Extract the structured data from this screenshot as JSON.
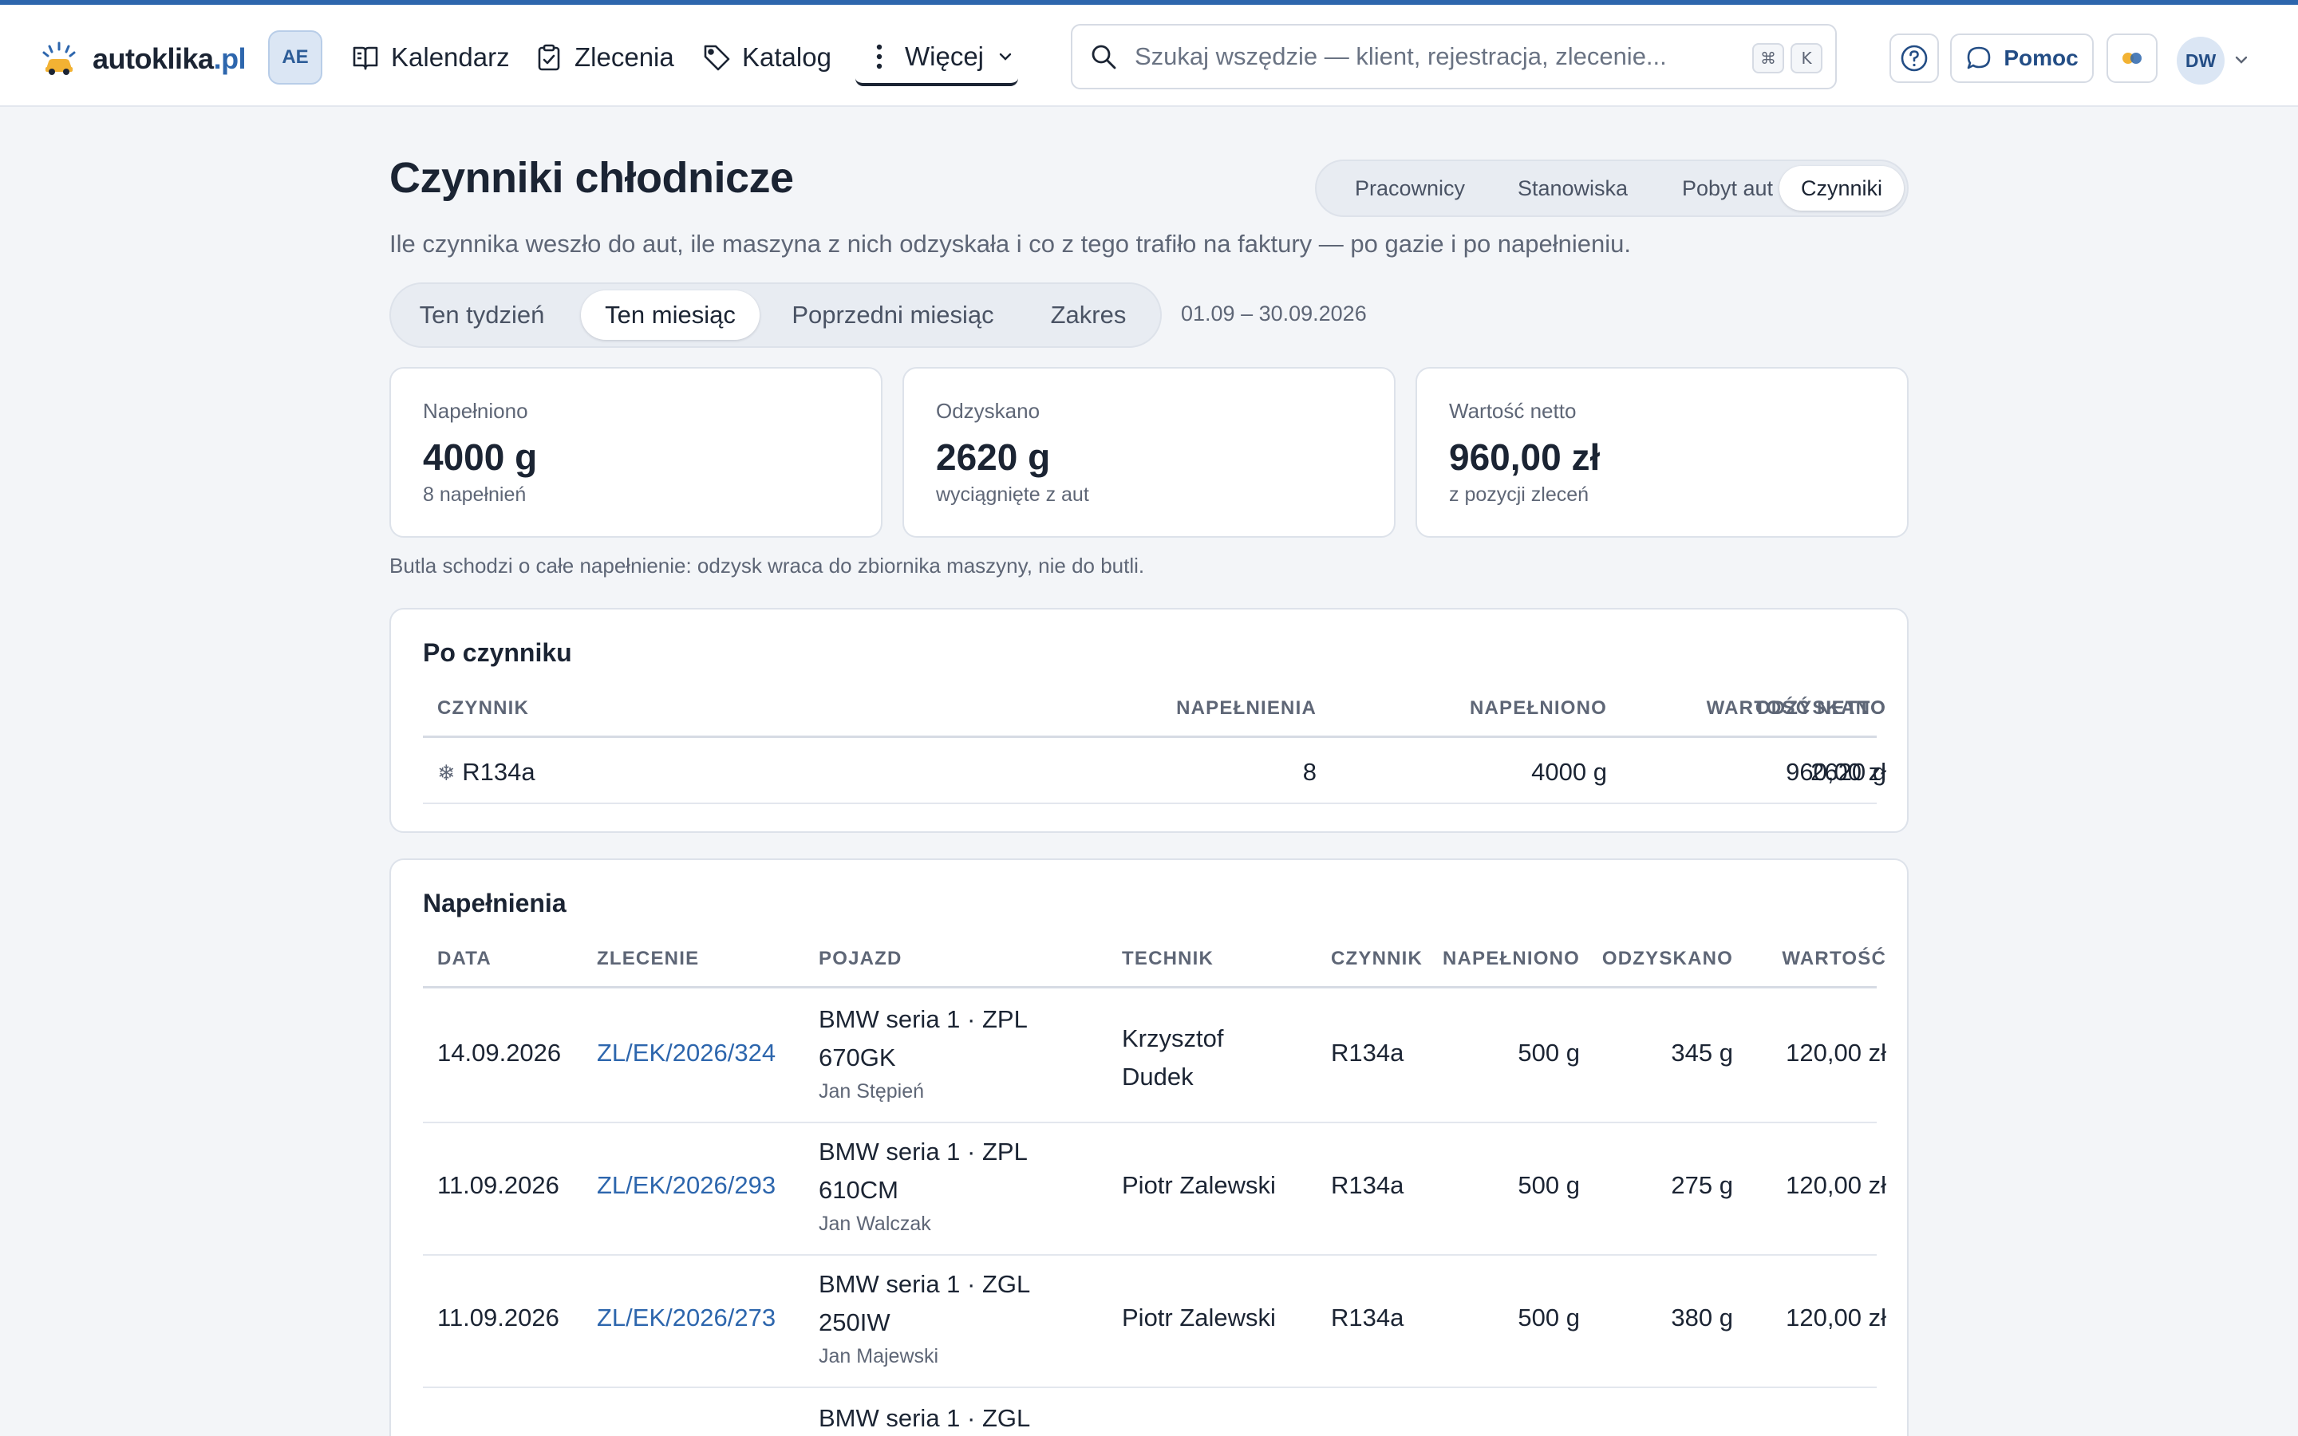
{
  "header": {
    "logo_name": "autoklika",
    "logo_tld": ".pl",
    "workspace_badge": "AE",
    "nav": {
      "calendar": "Kalendarz",
      "orders": "Zlecenia",
      "catalog": "Katalog",
      "more": "Więcej"
    },
    "search_placeholder": "Szukaj wszędzie — klient, rejestracja, zlecenie...",
    "search_kbd_1": "⌘",
    "search_kbd_2": "K",
    "help_label": "Pomoc",
    "user_initials": "DW",
    "accent_color": "#2d66ad"
  },
  "page": {
    "title": "Czynniki chłodnicze",
    "subtitle": "Ile czynnika weszło do aut, ile maszyna z nich odzyskała i co z tego trafiło na faktury — po gazie i po napełnieniu.",
    "report_tabs": [
      "Pracownicy",
      "Stanowiska",
      "Pobyt aut",
      "Czynniki"
    ],
    "active_report_tab": "Czynniki",
    "period_tabs": [
      "Ten tydzień",
      "Ten miesiąc",
      "Poprzedni miesiąc",
      "Zakres"
    ],
    "active_period_tab": "Ten miesiąc",
    "range": "01.09 – 30.09.2026"
  },
  "kpis": [
    {
      "label": "Napełniono",
      "value": "4000 g",
      "sub": "8 napełnień"
    },
    {
      "label": "Odzyskano",
      "value": "2620 g",
      "sub": "wyciągnięte z aut"
    },
    {
      "label": "Wartość netto",
      "value": "960,00 zł",
      "sub": "z pozycji zleceń"
    }
  ],
  "note": "Butla schodzi o całe napełnienie: odzysk wraca do zbiornika maszyny, nie do butli.",
  "by_agent": {
    "title": "Po czynniku",
    "columns": [
      "CZYNNIK",
      "NAPEŁNIENIA",
      "NAPEŁNIONO",
      "ODZYSKANO",
      "WARTOŚĆ NETTO"
    ],
    "rows": [
      {
        "icon": "❄",
        "agent": "R134a",
        "fills": "8",
        "filled": "4000 g",
        "recovered": "2620 g",
        "value": "960,00 zł"
      }
    ]
  },
  "fills": {
    "title": "Napełnienia",
    "columns": [
      "DATA",
      "ZLECENIE",
      "POJAZD",
      "TECHNIK",
      "CZYNNIK",
      "NAPEŁNIONO",
      "ODZYSKANO",
      "WARTOŚĆ"
    ],
    "rows": [
      {
        "date": "14.09.2026",
        "order": "ZL/EK/2026/324",
        "vehicle_1": "BMW seria 1 · ZPL",
        "vehicle_2": "670GK",
        "owner": "Jan Stępień",
        "tech_1": "Krzysztof",
        "tech_2": "Dudek",
        "agent": "R134a",
        "filled": "500 g",
        "recovered": "345 g",
        "value": "120,00 zł"
      },
      {
        "date": "11.09.2026",
        "order": "ZL/EK/2026/293",
        "vehicle_1": "BMW seria 1 · ZPL",
        "vehicle_2": "610CM",
        "owner": "Jan Walczak",
        "tech_1": "Piotr Zalewski",
        "tech_2": "",
        "agent": "R134a",
        "filled": "500 g",
        "recovered": "275 g",
        "value": "120,00 zł"
      },
      {
        "date": "11.09.2026",
        "order": "ZL/EK/2026/273",
        "vehicle_1": "BMW seria 1 · ZGL",
        "vehicle_2": "250IW",
        "owner": "Jan Majewski",
        "tech_1": "Piotr Zalewski",
        "tech_2": "",
        "agent": "R134a",
        "filled": "500 g",
        "recovered": "380 g",
        "value": "120,00 zł"
      },
      {
        "date": "",
        "order": "",
        "vehicle_1": "BMW seria 1 · ZGL",
        "vehicle_2": "",
        "owner": "",
        "tech_1": "",
        "tech_2": "",
        "agent": "",
        "filled": "",
        "recovered": "",
        "value": ""
      }
    ]
  }
}
